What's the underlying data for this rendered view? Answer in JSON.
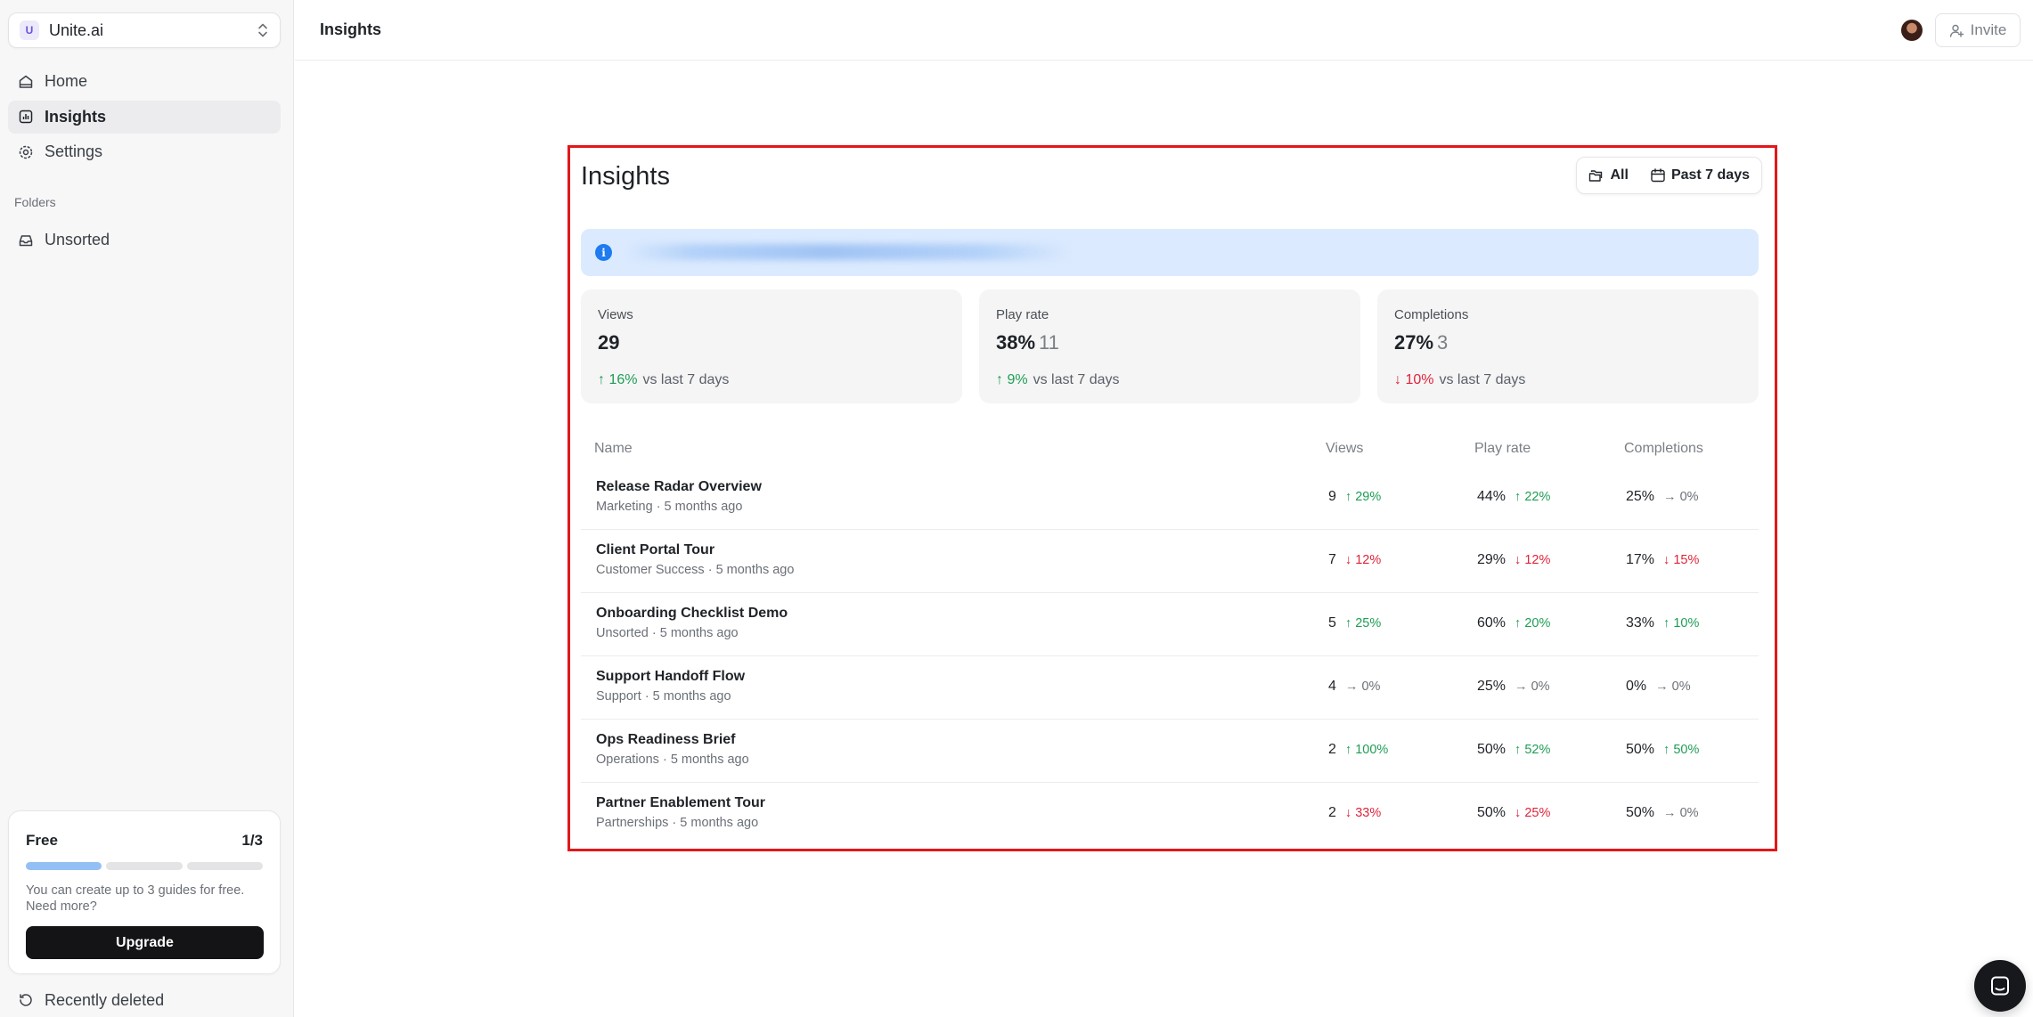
{
  "workspace": {
    "avatar_letter": "U",
    "name": "Unite.ai"
  },
  "nav": {
    "items": [
      {
        "label": "Home",
        "icon": "home-icon"
      },
      {
        "label": "Insights",
        "icon": "chart-icon",
        "active": true
      },
      {
        "label": "Settings",
        "icon": "gear-icon"
      }
    ]
  },
  "folders": {
    "label": "Folders",
    "items": [
      {
        "label": "Unsorted",
        "icon": "inbox-icon"
      }
    ]
  },
  "plan": {
    "name": "Free",
    "usage": "1/3",
    "used": 1,
    "total": 3,
    "text": "You can create up to 3 guides for free. Need more?",
    "upgrade_label": "Upgrade"
  },
  "recently_deleted": "Recently deleted",
  "topbar": {
    "title": "Insights",
    "invite_label": "Invite"
  },
  "panel": {
    "title": "Insights",
    "filters": {
      "scope": "All",
      "range": "Past 7 days"
    },
    "stats": [
      {
        "label": "Views",
        "value": "29",
        "sub": "",
        "delta": "16%",
        "trend": "up",
        "compare": "vs last 7 days"
      },
      {
        "label": "Play rate",
        "value": "38%",
        "sub": "11",
        "delta": "9%",
        "trend": "up",
        "compare": "vs last 7 days"
      },
      {
        "label": "Completions",
        "value": "27%",
        "sub": "3",
        "delta": "10%",
        "trend": "down",
        "compare": "vs last 7 days"
      }
    ],
    "table": {
      "columns": [
        "Name",
        "Views",
        "Play rate",
        "Completions"
      ],
      "rows": [
        {
          "title": "Release Radar Overview",
          "subtitle": "Marketing · 5 months ago",
          "views": "9",
          "views_delta": "29%",
          "views_trend": "up",
          "play": "44%",
          "play_delta": "22%",
          "play_trend": "up",
          "comp": "25%",
          "comp_delta": "0%",
          "comp_trend": "flat"
        },
        {
          "title": "Client Portal Tour",
          "subtitle": "Customer Success · 5 months ago",
          "views": "7",
          "views_delta": "12%",
          "views_trend": "down",
          "play": "29%",
          "play_delta": "12%",
          "play_trend": "down",
          "comp": "17%",
          "comp_delta": "15%",
          "comp_trend": "down"
        },
        {
          "title": "Onboarding Checklist Demo",
          "subtitle": "Unsorted · 5 months ago",
          "views": "5",
          "views_delta": "25%",
          "views_trend": "up",
          "play": "60%",
          "play_delta": "20%",
          "play_trend": "up",
          "comp": "33%",
          "comp_delta": "10%",
          "comp_trend": "up"
        },
        {
          "title": "Support Handoff Flow",
          "subtitle": "Support · 5 months ago",
          "views": "4",
          "views_delta": "0%",
          "views_trend": "flat",
          "play": "25%",
          "play_delta": "0%",
          "play_trend": "flat",
          "comp": "0%",
          "comp_delta": "0%",
          "comp_trend": "flat"
        },
        {
          "title": "Ops Readiness Brief",
          "subtitle": "Operations · 5 months ago",
          "views": "2",
          "views_delta": "100%",
          "views_trend": "up",
          "play": "50%",
          "play_delta": "52%",
          "play_trend": "up",
          "comp": "50%",
          "comp_delta": "50%",
          "comp_trend": "up"
        },
        {
          "title": "Partner Enablement Tour",
          "subtitle": "Partnerships · 5 months ago",
          "views": "2",
          "views_delta": "33%",
          "views_trend": "down",
          "play": "50%",
          "play_delta": "25%",
          "play_trend": "down",
          "comp": "50%",
          "comp_delta": "0%",
          "comp_trend": "flat"
        }
      ]
    }
  },
  "colors": {
    "up": "#1f9d55",
    "down": "#e0243b",
    "flat": "#6b7077",
    "highlight": "#e3171b",
    "banner": "#dbeafe"
  }
}
